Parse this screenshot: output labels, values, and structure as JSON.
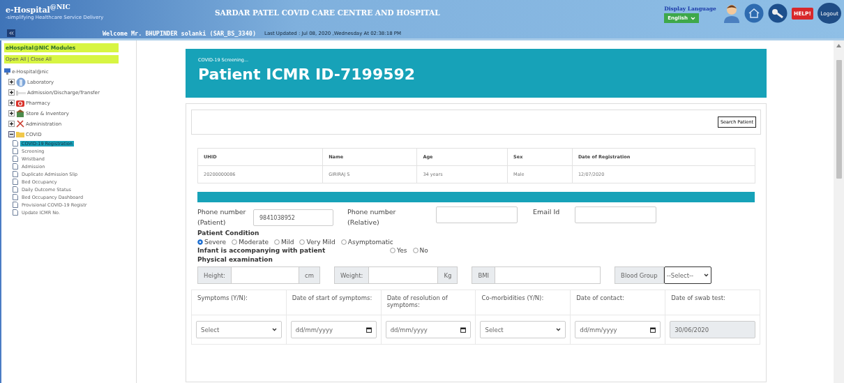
{
  "header": {
    "logo": "e-Hospital$^{@NIC}$",
    "tagline": "-simplifying Healthcare Service Delivery",
    "title": "SARDAR PATEL COVID CARE CENTRE AND HOSPITAL",
    "welcome": "Welcome Mr. BHUPINDER solanki (SAR_BS_3340)",
    "last_updated": "Last Updated : Jul 08, 2020 ,Wednesday At 02:38:18 PM",
    "language_label": "Display Language",
    "language": "English",
    "help": "HELP!",
    "logout": "Logout"
  },
  "sidebar": {
    "title": "eHospital@NIC Modules",
    "open_all": "Open All",
    "separator": "|",
    "close_all": "Close All",
    "tree": {
      "label": "e-Hospital@nic",
      "children": [
        {
          "label": "Laboratory",
          "kind": "lab",
          "expanded": false
        },
        {
          "label": "Admission/Discharge/Transfer",
          "kind": "adt",
          "expanded": false
        },
        {
          "label": "Pharmacy",
          "kind": "pharmacy",
          "expanded": false
        },
        {
          "label": "Store & Inventory",
          "kind": "store",
          "expanded": false
        },
        {
          "label": "Administration",
          "kind": "admin",
          "expanded": false
        },
        {
          "label": "COVID",
          "kind": "folder",
          "expanded": true,
          "children": [
            {
              "label": "COVID-19 Registration",
              "selected": true
            },
            {
              "label": "Screening",
              "selected": false
            },
            {
              "label": "Wristband",
              "selected": false
            },
            {
              "label": "Admission",
              "selected": false
            },
            {
              "label": "Duplicate Admission Slip",
              "selected": false
            },
            {
              "label": "Bed Occupancy",
              "selected": false
            },
            {
              "label": "Daily Outcome Status",
              "selected": false
            },
            {
              "label": "Bed Occupancy Dashboard",
              "selected": false
            },
            {
              "label": "Provisional COVID-19 Registr",
              "selected": false
            },
            {
              "label": "Update ICMR No.",
              "selected": false
            }
          ]
        }
      ]
    }
  },
  "banner": {
    "subtitle": "COVID-19 Screening...",
    "title": "Patient ICMR ID-7199592"
  },
  "search_button": "Search Patient",
  "patient_table": {
    "columns": [
      "UHID",
      "Name",
      "Age",
      "Sex",
      "Date of Registration"
    ],
    "rows": [
      [
        "20200000086",
        "GIRIRAJ S",
        "34 years",
        "Male",
        "12/07/2020"
      ]
    ]
  },
  "contact": {
    "phone_patient_label": "Phone number (Patient)",
    "phone_patient": "9841038952",
    "phone_relative_label": "Phone number (Relative)",
    "email_label": "Email Id"
  },
  "patient_condition": {
    "label": "Patient Condition",
    "options": [
      {
        "label": "Severe",
        "selected": true
      },
      {
        "label": "Moderate",
        "selected": false
      },
      {
        "label": "Mild",
        "selected": false
      },
      {
        "label": "Very Mild",
        "selected": false
      },
      {
        "label": "Asymptomatic",
        "selected": false
      }
    ]
  },
  "infant": {
    "label": "Infant is accompanying with patient",
    "options": [
      {
        "label": "Yes",
        "selected": false
      },
      {
        "label": "No",
        "selected": false
      }
    ]
  },
  "physical": {
    "label": "Physical examination",
    "height_label": "Height:",
    "height_unit": "cm",
    "weight_label": "Weight:",
    "weight_unit": "Kg",
    "bmi_label": "BMI",
    "blood_group_label": "Blood Group",
    "blood_group": "--Select--"
  },
  "symptoms_table": {
    "columns": [
      "Symptoms (Y/N):",
      "Date of start of symptoms:",
      "Date of resolution of symptoms:",
      "Co-morbidities (Y/N):",
      "Date of contact:",
      "Date of swab test:"
    ],
    "cells": [
      {
        "kind": "select",
        "value": "Select"
      },
      {
        "kind": "date",
        "value": "dd/mm/yyyy"
      },
      {
        "kind": "date",
        "value": "dd/mm/yyyy"
      },
      {
        "kind": "select",
        "value": "Select"
      },
      {
        "kind": "date",
        "value": "dd/mm/yyyy"
      },
      {
        "kind": "readonly",
        "value": "30/06/2020"
      }
    ]
  }
}
